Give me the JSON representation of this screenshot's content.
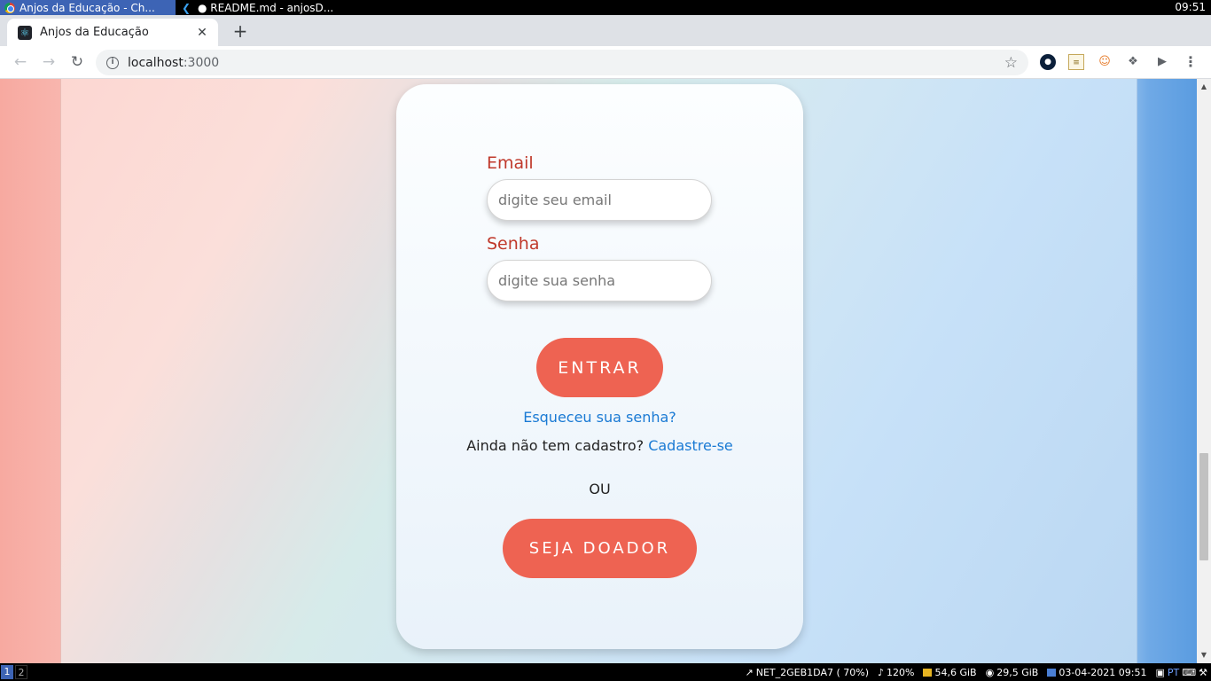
{
  "os": {
    "tasks": [
      {
        "label": "Anjos da Educação - Ch...",
        "icon": "chrome-icon"
      },
      {
        "label": "● README.md - anjosD...",
        "icon": "vscode-icon"
      }
    ],
    "clock": "09:51",
    "workspaces": [
      "1",
      "2"
    ],
    "tray": {
      "network": "NET_2GEB1DA7 ( 70%)",
      "volume": "120%",
      "disk1": "54,6 GiB",
      "disk2": "29,5 GiB",
      "datetime": "03-04-2021 09:51",
      "lang": "PT"
    }
  },
  "browser": {
    "tab_title": "Anjos da Educação",
    "tab_close": "✕",
    "new_tab": "+",
    "url_host": "localhost",
    "url_port": ":3000"
  },
  "login": {
    "email_label": "Email",
    "email_placeholder": "digite seu email",
    "password_label": "Senha",
    "password_placeholder": "digite sua senha",
    "submit_label": "ENTRAR",
    "forgot_link": "Esqueceu sua senha?",
    "signup_prompt": "Ainda não tem cadastro? ",
    "signup_link": "Cadastre-se",
    "or_text": "OU",
    "donor_label": "SEJA DOADOR"
  },
  "colors": {
    "accent": "#ee6352",
    "label": "#c0392b",
    "link": "#1a7ad4"
  }
}
